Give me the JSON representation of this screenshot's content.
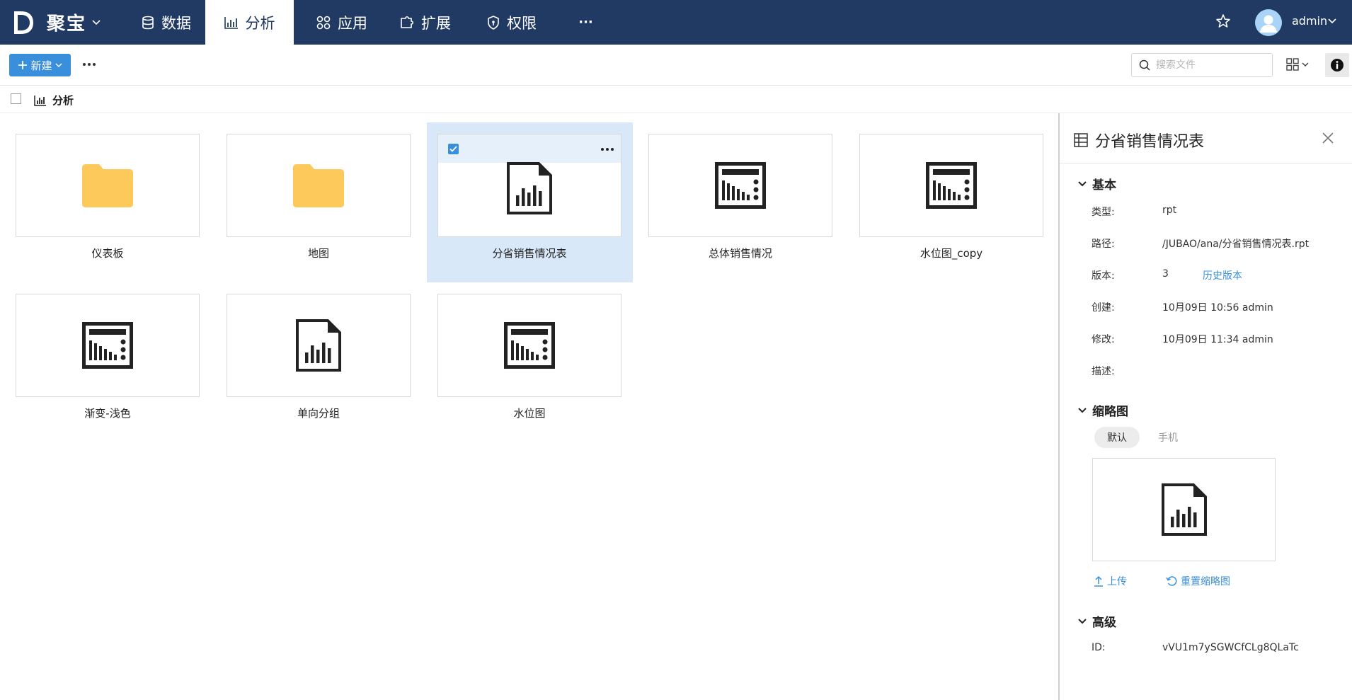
{
  "app": {
    "brand_name": "聚宝",
    "brand_letter": "D"
  },
  "nav": {
    "tabs": [
      {
        "label": "数据",
        "icon": "database-icon"
      },
      {
        "label": "分析",
        "icon": "bar-chart-icon",
        "active": true
      },
      {
        "label": "应用",
        "icon": "apps-icon"
      },
      {
        "label": "扩展",
        "icon": "puzzle-icon"
      },
      {
        "label": "权限",
        "icon": "shield-icon"
      }
    ],
    "more": "···",
    "user": "admin"
  },
  "toolbar": {
    "new_label": "新建",
    "search_placeholder": "搜索文件"
  },
  "breadcrumb": {
    "label": "分析"
  },
  "files": [
    {
      "name": "仪表板",
      "kind": "folder"
    },
    {
      "name": "地图",
      "kind": "folder"
    },
    {
      "name": "分省销售情况表",
      "kind": "report",
      "selected": true
    },
    {
      "name": "总体销售情况",
      "kind": "dashboard"
    },
    {
      "name": "水位图_copy",
      "kind": "dashboard"
    },
    {
      "name": "渐变-浅色",
      "kind": "dashboard"
    },
    {
      "name": "单向分组",
      "kind": "report"
    },
    {
      "name": "水位图",
      "kind": "dashboard"
    }
  ],
  "panel": {
    "title": "分省销售情况表",
    "basic": {
      "section": "基本",
      "type_label": "类型:",
      "type_value": "rpt",
      "path_label": "路径:",
      "path_value": "/JUBAO/ana/分省销售情况表.rpt",
      "version_label": "版本:",
      "version_value": "3",
      "history_link": "历史版本",
      "created_label": "创建:",
      "created_value": "10月09日 10:56 admin",
      "modified_label": "修改:",
      "modified_value": "10月09日 11:34 admin",
      "desc_label": "描述:"
    },
    "thumbnail": {
      "section": "缩略图",
      "tab_default": "默认",
      "tab_mobile": "手机",
      "upload": "上传",
      "reset": "重置缩略图"
    },
    "advanced": {
      "section": "高级",
      "id_label": "ID:",
      "id_value": "vVU1m7ySGWCfCLg8QLaTc"
    }
  },
  "colors": {
    "nav_bg": "#213a63",
    "accent": "#3a8fdc",
    "folder": "#fdc95b",
    "selected_bg": "#d8e8f9"
  }
}
